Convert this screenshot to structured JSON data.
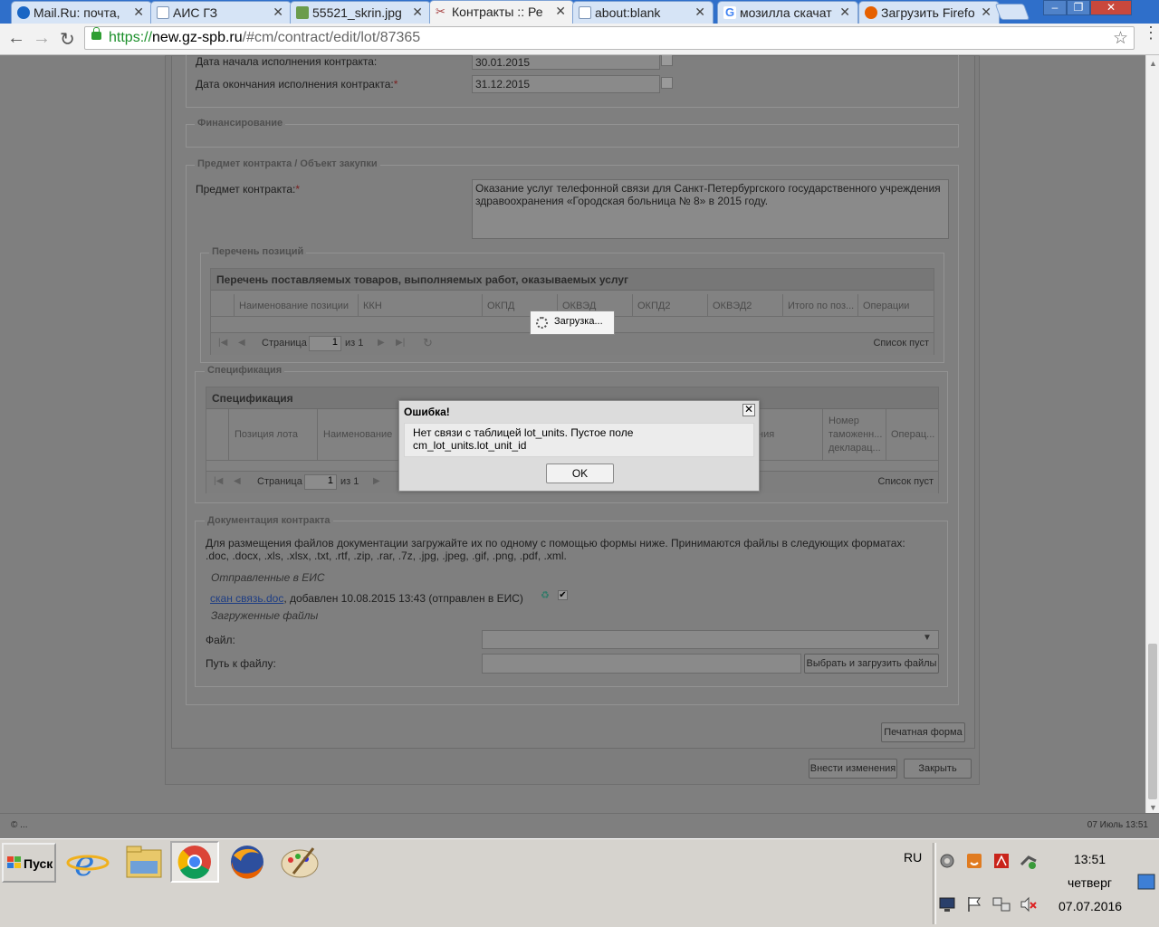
{
  "browser": {
    "tabs": [
      {
        "title": "Mail.Ru: почта,",
        "icon": "mailru-icon",
        "color": "#1a66c4"
      },
      {
        "title": "АИС ГЗ",
        "icon": "document-icon",
        "color": "#9bb6d8"
      },
      {
        "title": "55521_skrin.jpg",
        "icon": "image-icon",
        "color": "#6b9c4c"
      },
      {
        "title": "Контракты :: Ре",
        "icon": "tools-icon",
        "color": "#a64040",
        "active": true
      },
      {
        "title": "about:blank",
        "icon": "document-icon",
        "color": "#9bb6d8"
      },
      {
        "title": "мозилла скачат",
        "icon": "google-icon",
        "color": "#4285f4"
      },
      {
        "title": "Загрузить Firefo",
        "icon": "firefox-icon",
        "color": "#e66000"
      }
    ],
    "url_scheme": "https://",
    "url_host": "new.gz-spb.ru",
    "url_path": "/#cm/contract/edit/lot/87365"
  },
  "form": {
    "start_label": "Дата начала исполнения контракта:",
    "start_value": "30.01.2015",
    "end_label": "Дата окончания исполнения контракта:",
    "end_value": "31.12.2015",
    "required_mark": "*",
    "financing_legend": "Финансирование",
    "subject_legend": "Предмет контракта / Объект закупки",
    "subject_label": "Предмет контракта:",
    "subject_value": "Оказание услуг телефонной связи для Санкт-Петербургского государственного учреждения здравоохранения «Городская больница № 8» в 2015 году.",
    "positions_legend": "Перечень позиций",
    "positions_grid_title": "Перечень поставляемых товаров, выполняемых работ, оказываемых услуг",
    "positions_columns": [
      "Наименование позиции",
      "ККН",
      "ОКПД",
      "ОКВЭД",
      "ОКПД2",
      "ОКВЭД2",
      "Итого по поз...",
      "Операции"
    ],
    "pager_page": "Страница",
    "pager_value": "1",
    "pager_of": "из 1",
    "pager_empty": "Список пуст",
    "spec_legend": "Спецификация",
    "spec_grid_title": "Спецификация",
    "spec_columns": [
      "Позиция лота",
      "Наименование",
      "ния",
      "Номер таможенн... декларац...",
      "Операц..."
    ],
    "docs_legend": "Документация контракта",
    "docs_hint": "Для размещения файлов документации загружайте их по одному с помощью формы ниже. Принимаются файлы в следующих форматах: .doc, .docx, .xls, .xlsx, .txt, .rtf, .zip, .rar, .7z, .jpg, .jpeg, .gif, .png, .pdf, .xml.",
    "sent_header": "Отправленные в ЕИС",
    "file_link": "скан связь.doc",
    "file_info": ", добавлен 10.08.2015 13:43 (отправлен в ЕИС)",
    "uploaded_header": "Загруженные файлы",
    "file_label": "Файл:",
    "path_label": "Путь к файлу:",
    "choose_button": "Выбрать и загрузить файлы",
    "print_button": "Печатная форма",
    "save_button": "Внести изменения",
    "close_button": "Закрыть"
  },
  "loading": {
    "text": "Загрузка..."
  },
  "dialog": {
    "title": "Ошибка!",
    "message_line1": "Нет связи с таблицей lot_units. Пустое поле",
    "message_line2": "cm_lot_units.lot_unit_id",
    "ok": "OK"
  },
  "page_footer": {
    "left": "© ...",
    "right": "07 Июль 13:51"
  },
  "taskbar": {
    "start": "Пуск",
    "lang": "RU",
    "time": "13:51",
    "day": "четверг",
    "date": "07.07.2016"
  }
}
